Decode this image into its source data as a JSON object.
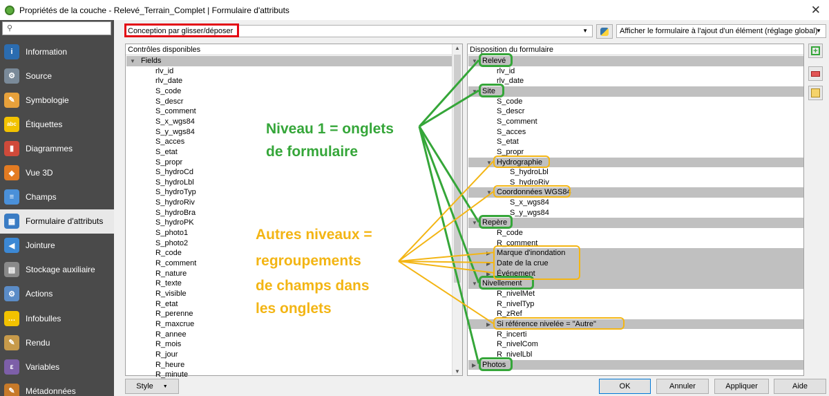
{
  "window": {
    "title": "Propriétés de la couche - Relevé_Terrain_Complet | Formulaire d'attributs",
    "close_glyph": "✕"
  },
  "nav": {
    "search_placeholder": "",
    "items": [
      {
        "label": "Information",
        "icon": "information-icon",
        "color": "#2b6cb0",
        "glyph": "i"
      },
      {
        "label": "Source",
        "icon": "source-icon",
        "color": "#7a8a99",
        "glyph": "⚙"
      },
      {
        "label": "Symbologie",
        "icon": "symbology-icon",
        "color": "#e7a13b",
        "glyph": "✎"
      },
      {
        "label": "Étiquettes",
        "icon": "labels-icon",
        "color": "#f2c200",
        "glyph": "abc"
      },
      {
        "label": "Diagrammes",
        "icon": "diagrams-icon",
        "color": "#d04a3a",
        "glyph": "▮"
      },
      {
        "label": "Vue 3D",
        "icon": "view3d-icon",
        "color": "#e37b22",
        "glyph": "◆"
      },
      {
        "label": "Champs",
        "icon": "fields-icon",
        "color": "#4a90d9",
        "glyph": "≡"
      },
      {
        "label": "Formulaire d'attributs",
        "icon": "attributes-form-icon",
        "color": "#3a7cc4",
        "glyph": "▦"
      },
      {
        "label": "Jointure",
        "icon": "join-icon",
        "color": "#3c88d4",
        "glyph": "◀"
      },
      {
        "label": "Stockage auxiliaire",
        "icon": "auxiliary-storage-icon",
        "color": "#8a8a8a",
        "glyph": "▤"
      },
      {
        "label": "Actions",
        "icon": "actions-icon",
        "color": "#5b8cc7",
        "glyph": "⚙"
      },
      {
        "label": "Infobulles",
        "icon": "tooltips-icon",
        "color": "#f2c200",
        "glyph": "…"
      },
      {
        "label": "Rendu",
        "icon": "rendering-icon",
        "color": "#c79a4a",
        "glyph": "✎"
      },
      {
        "label": "Variables",
        "icon": "variables-icon",
        "color": "#7d5fa8",
        "glyph": "ε"
      },
      {
        "label": "Métadonnées",
        "icon": "metadata-icon",
        "color": "#c77a2a",
        "glyph": "✎"
      }
    ],
    "active_index": 7
  },
  "toolbar": {
    "mode_value": "Conception par glisser/déposer",
    "show_form_value": "Afficher le formulaire à l'ajout d'un élément (réglage global)"
  },
  "left_panel": {
    "header": "Contrôles disponibles",
    "root": "Fields",
    "fields": [
      "rlv_id",
      "rlv_date",
      "S_code",
      "S_descr",
      "S_comment",
      "S_x_wgs84",
      "S_y_wgs84",
      "S_acces",
      "S_etat",
      "S_propr",
      "S_hydroCd",
      "S_hydroLbl",
      "S_hydroTyp",
      "S_hydroRiv",
      "S_hydroBra",
      "S_hydroPK",
      "S_photo1",
      "S_photo2",
      "R_code",
      "R_comment",
      "R_nature",
      "R_texte",
      "R_visible",
      "R_etat",
      "R_perenne",
      "R_maxcrue",
      "R_annee",
      "R_mois",
      "R_jour",
      "R_heure",
      "R_minute"
    ]
  },
  "right_panel": {
    "header": "Disposition du formulaire",
    "rows": [
      {
        "text": "Relevé",
        "level": 0,
        "group": true,
        "expanded": true
      },
      {
        "text": "rlv_id",
        "level": 1
      },
      {
        "text": "rlv_date",
        "level": 1
      },
      {
        "text": "Site",
        "level": 0,
        "group": true,
        "expanded": true
      },
      {
        "text": "S_code",
        "level": 1
      },
      {
        "text": "S_descr",
        "level": 1
      },
      {
        "text": "S_comment",
        "level": 1
      },
      {
        "text": "S_acces",
        "level": 1
      },
      {
        "text": "S_etat",
        "level": 1
      },
      {
        "text": "S_propr",
        "level": 1
      },
      {
        "text": "Hydrographie",
        "level": 1,
        "group": true,
        "expanded": true
      },
      {
        "text": "S_hydroLbl",
        "level": 2
      },
      {
        "text": "S_hydroRiv",
        "level": 2
      },
      {
        "text": "Coordonnées WGS84",
        "level": 1,
        "group": true,
        "expanded": true
      },
      {
        "text": "S_x_wgs84",
        "level": 2
      },
      {
        "text": "S_y_wgs84",
        "level": 2
      },
      {
        "text": "Repère",
        "level": 0,
        "group": true,
        "expanded": true
      },
      {
        "text": "R_code",
        "level": 1
      },
      {
        "text": "R_comment",
        "level": 1
      },
      {
        "text": "Marque d'inondation",
        "level": 1,
        "group": true,
        "expanded": false
      },
      {
        "text": "Date de la crue",
        "level": 1,
        "group": true,
        "expanded": false
      },
      {
        "text": "Événement",
        "level": 1,
        "group": true,
        "expanded": false
      },
      {
        "text": "Nivellement",
        "level": 0,
        "group": true,
        "expanded": true
      },
      {
        "text": "R_nivelMet",
        "level": 1
      },
      {
        "text": "R_nivelTyp",
        "level": 1
      },
      {
        "text": "R_zRef",
        "level": 1
      },
      {
        "text": "Si référence nivelée = \"Autre\"",
        "level": 1,
        "group": true,
        "expanded": false
      },
      {
        "text": "R_incerti",
        "level": 1
      },
      {
        "text": "R_nivelCom",
        "level": 1
      },
      {
        "text": "R_nivelLbl",
        "level": 1
      },
      {
        "text": "Photos",
        "level": 0,
        "group": true,
        "expanded": false
      }
    ]
  },
  "side_buttons": [
    {
      "icon": "add-container-icon"
    },
    {
      "icon": "remove-icon"
    },
    {
      "icon": "edit-icon"
    }
  ],
  "bottom": {
    "style_label": "Style",
    "ok_label": "OK",
    "cancel_label": "Annuler",
    "apply_label": "Appliquer",
    "help_label": "Aide"
  },
  "annotations": {
    "level1_line1": "Niveau 1 = onglets",
    "level1_line2": "de formulaire",
    "other_line1": "Autres niveaux =",
    "other_line2": "regroupements",
    "other_line3": "de champs dans",
    "other_line4": "les onglets",
    "green": "#35a639",
    "yellow": "#f3b514",
    "red": "#e30613"
  }
}
